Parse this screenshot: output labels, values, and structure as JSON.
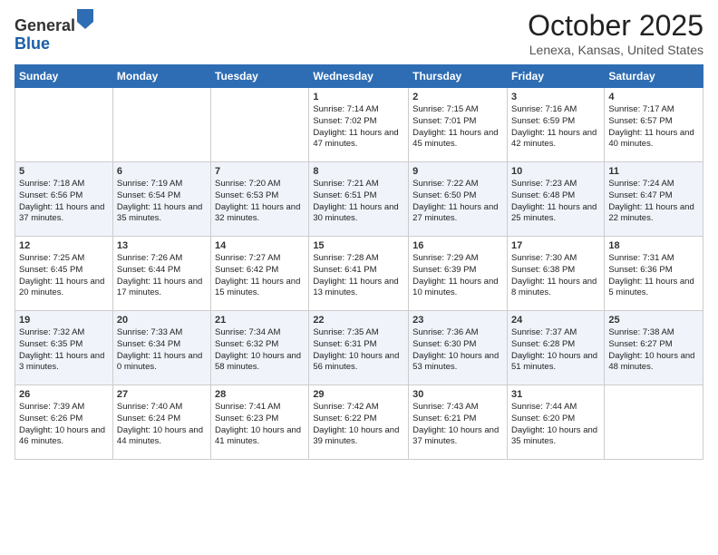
{
  "header": {
    "logo_general": "General",
    "logo_blue": "Blue",
    "month_title": "October 2025",
    "location": "Lenexa, Kansas, United States"
  },
  "days_of_week": [
    "Sunday",
    "Monday",
    "Tuesday",
    "Wednesday",
    "Thursday",
    "Friday",
    "Saturday"
  ],
  "weeks": [
    [
      {
        "day": "",
        "info": ""
      },
      {
        "day": "",
        "info": ""
      },
      {
        "day": "",
        "info": ""
      },
      {
        "day": "1",
        "info": "Sunrise: 7:14 AM\nSunset: 7:02 PM\nDaylight: 11 hours and 47 minutes."
      },
      {
        "day": "2",
        "info": "Sunrise: 7:15 AM\nSunset: 7:01 PM\nDaylight: 11 hours and 45 minutes."
      },
      {
        "day": "3",
        "info": "Sunrise: 7:16 AM\nSunset: 6:59 PM\nDaylight: 11 hours and 42 minutes."
      },
      {
        "day": "4",
        "info": "Sunrise: 7:17 AM\nSunset: 6:57 PM\nDaylight: 11 hours and 40 minutes."
      }
    ],
    [
      {
        "day": "5",
        "info": "Sunrise: 7:18 AM\nSunset: 6:56 PM\nDaylight: 11 hours and 37 minutes."
      },
      {
        "day": "6",
        "info": "Sunrise: 7:19 AM\nSunset: 6:54 PM\nDaylight: 11 hours and 35 minutes."
      },
      {
        "day": "7",
        "info": "Sunrise: 7:20 AM\nSunset: 6:53 PM\nDaylight: 11 hours and 32 minutes."
      },
      {
        "day": "8",
        "info": "Sunrise: 7:21 AM\nSunset: 6:51 PM\nDaylight: 11 hours and 30 minutes."
      },
      {
        "day": "9",
        "info": "Sunrise: 7:22 AM\nSunset: 6:50 PM\nDaylight: 11 hours and 27 minutes."
      },
      {
        "day": "10",
        "info": "Sunrise: 7:23 AM\nSunset: 6:48 PM\nDaylight: 11 hours and 25 minutes."
      },
      {
        "day": "11",
        "info": "Sunrise: 7:24 AM\nSunset: 6:47 PM\nDaylight: 11 hours and 22 minutes."
      }
    ],
    [
      {
        "day": "12",
        "info": "Sunrise: 7:25 AM\nSunset: 6:45 PM\nDaylight: 11 hours and 20 minutes."
      },
      {
        "day": "13",
        "info": "Sunrise: 7:26 AM\nSunset: 6:44 PM\nDaylight: 11 hours and 17 minutes."
      },
      {
        "day": "14",
        "info": "Sunrise: 7:27 AM\nSunset: 6:42 PM\nDaylight: 11 hours and 15 minutes."
      },
      {
        "day": "15",
        "info": "Sunrise: 7:28 AM\nSunset: 6:41 PM\nDaylight: 11 hours and 13 minutes."
      },
      {
        "day": "16",
        "info": "Sunrise: 7:29 AM\nSunset: 6:39 PM\nDaylight: 11 hours and 10 minutes."
      },
      {
        "day": "17",
        "info": "Sunrise: 7:30 AM\nSunset: 6:38 PM\nDaylight: 11 hours and 8 minutes."
      },
      {
        "day": "18",
        "info": "Sunrise: 7:31 AM\nSunset: 6:36 PM\nDaylight: 11 hours and 5 minutes."
      }
    ],
    [
      {
        "day": "19",
        "info": "Sunrise: 7:32 AM\nSunset: 6:35 PM\nDaylight: 11 hours and 3 minutes."
      },
      {
        "day": "20",
        "info": "Sunrise: 7:33 AM\nSunset: 6:34 PM\nDaylight: 11 hours and 0 minutes."
      },
      {
        "day": "21",
        "info": "Sunrise: 7:34 AM\nSunset: 6:32 PM\nDaylight: 10 hours and 58 minutes."
      },
      {
        "day": "22",
        "info": "Sunrise: 7:35 AM\nSunset: 6:31 PM\nDaylight: 10 hours and 56 minutes."
      },
      {
        "day": "23",
        "info": "Sunrise: 7:36 AM\nSunset: 6:30 PM\nDaylight: 10 hours and 53 minutes."
      },
      {
        "day": "24",
        "info": "Sunrise: 7:37 AM\nSunset: 6:28 PM\nDaylight: 10 hours and 51 minutes."
      },
      {
        "day": "25",
        "info": "Sunrise: 7:38 AM\nSunset: 6:27 PM\nDaylight: 10 hours and 48 minutes."
      }
    ],
    [
      {
        "day": "26",
        "info": "Sunrise: 7:39 AM\nSunset: 6:26 PM\nDaylight: 10 hours and 46 minutes."
      },
      {
        "day": "27",
        "info": "Sunrise: 7:40 AM\nSunset: 6:24 PM\nDaylight: 10 hours and 44 minutes."
      },
      {
        "day": "28",
        "info": "Sunrise: 7:41 AM\nSunset: 6:23 PM\nDaylight: 10 hours and 41 minutes."
      },
      {
        "day": "29",
        "info": "Sunrise: 7:42 AM\nSunset: 6:22 PM\nDaylight: 10 hours and 39 minutes."
      },
      {
        "day": "30",
        "info": "Sunrise: 7:43 AM\nSunset: 6:21 PM\nDaylight: 10 hours and 37 minutes."
      },
      {
        "day": "31",
        "info": "Sunrise: 7:44 AM\nSunset: 6:20 PM\nDaylight: 10 hours and 35 minutes."
      },
      {
        "day": "",
        "info": ""
      }
    ]
  ]
}
